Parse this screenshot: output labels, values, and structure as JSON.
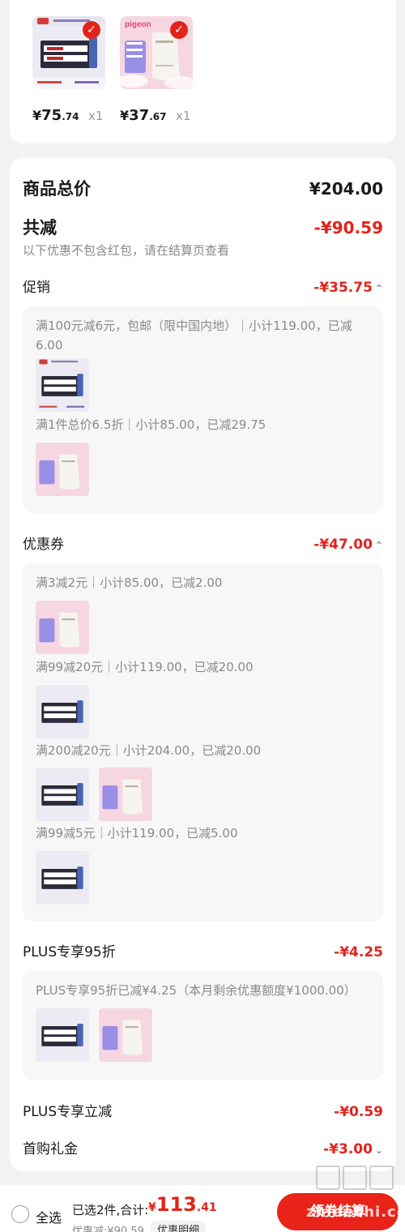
{
  "cart_items": [
    {
      "name": "product-milk-powder",
      "price_int": "75",
      "price_dec": ".74",
      "qty": "x1"
    },
    {
      "name": "product-pigeon-cream",
      "price_int": "37",
      "price_dec": ".67",
      "qty": "x1"
    }
  ],
  "currency": "¥",
  "summary": {
    "total_label": "商品总价",
    "total_value": "¥204.00",
    "discount_label": "共减",
    "discount_value": "-¥90.59",
    "note": "以下优惠不包含红包，请在结算页查看"
  },
  "promo": {
    "title": "促销",
    "value": "-¥35.75",
    "lines": [
      "满100元减6元，包邮（限中国内地）｜小计119.00，已减6.00",
      "满1件总价6.5折｜小计85.00，已减29.75"
    ]
  },
  "coupon": {
    "title": "优惠券",
    "value": "-¥47.00",
    "lines": [
      "满3减2元｜小计85.00，已减2.00",
      "满99减20元｜小计119.00，已减20.00",
      "满200减20元｜小计204.00，已减20.00",
      "满99减5元｜小计119.00，已减5.00"
    ]
  },
  "plus": {
    "title": "PLUS专享95折",
    "value": "-¥4.25",
    "line": "PLUS专享95折已减¥4.25（本月剩余优惠额度¥1000.00）"
  },
  "plus_instant": {
    "title": "PLUS专享立减",
    "value": "-¥0.59"
  },
  "first_gift": {
    "title": "首购礼金",
    "value": "-¥3.00"
  },
  "bottom": {
    "select_all": "全选",
    "selected_summary": "已选2件,合计:",
    "total_yen": "¥",
    "total_int": "113",
    "total_dec": ".41",
    "saved": "优惠减:¥90.59",
    "detail_btn": "优惠明细",
    "checkout": "领券结算"
  },
  "product_thumb_texts": {
    "pigeon_brand": "pigeon"
  },
  "watermark": "zhidechi.com",
  "colors": {
    "accent": "#e2231a",
    "bg": "#f2f2f2"
  }
}
